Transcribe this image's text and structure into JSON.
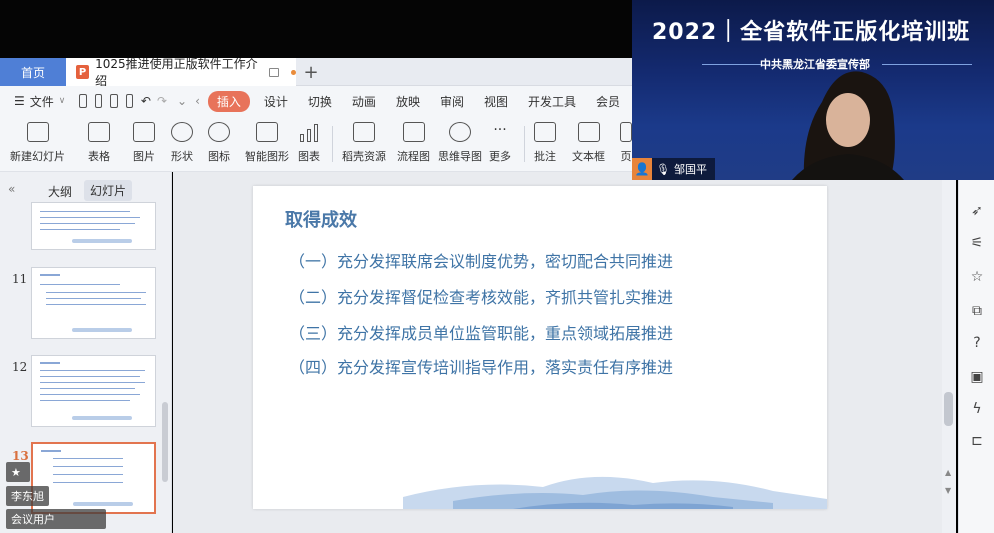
{
  "tabs": {
    "home": "首页",
    "document": "1025推进使用正版软件工作介绍"
  },
  "menu": {
    "file": "文件",
    "items": [
      "插入",
      "设计",
      "切换",
      "动画",
      "放映",
      "审阅",
      "视图",
      "开发工具",
      "会员"
    ]
  },
  "ribbon": {
    "items": [
      "新建幻灯片",
      "表格",
      "图片",
      "形状",
      "图标",
      "智能图形",
      "图表",
      "稻壳资源",
      "流程图",
      "思维导图",
      "更多",
      "批注",
      "文本框",
      "页"
    ]
  },
  "left_panel": {
    "tab_outline": "大纲",
    "tab_slides": "幻灯片",
    "slide_numbers": [
      "11",
      "12",
      "13"
    ],
    "badges": [
      "李东旭",
      "会议用户"
    ]
  },
  "slide": {
    "title": "取得成效",
    "bullets": [
      "（一）充分发挥联席会议制度优势，密切配合共同推进",
      "（二）充分发挥督促检查考核效能，齐抓共管扎实推进",
      "（三）充分发挥成员单位监管职能，重点领域拓展推进",
      "（四）充分发挥宣传培训指导作用，落实责任有序推进"
    ]
  },
  "video": {
    "banner_title": "2022｜全省软件正版化培训班",
    "banner_sub": "中共黑龙江省委宣传部",
    "speaker_name": "邹国平"
  },
  "colors": {
    "accent": "#e8735a",
    "home_tab": "#4f7fd6",
    "slide_text": "#3f74a6"
  }
}
